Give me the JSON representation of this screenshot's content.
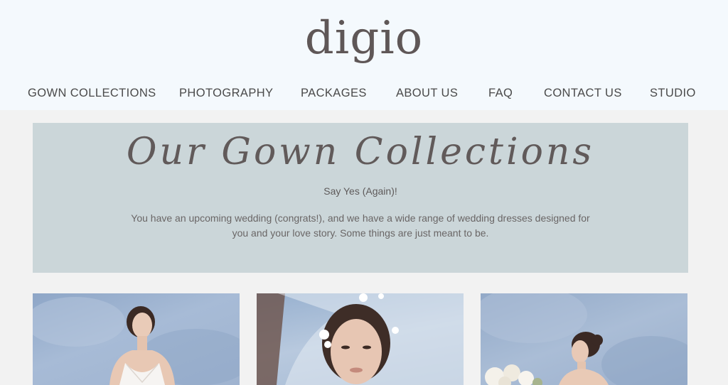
{
  "brand": {
    "logo_text": "digio"
  },
  "nav": {
    "items": [
      {
        "label": "GOWN COLLECTIONS"
      },
      {
        "label": "PHOTOGRAPHY"
      },
      {
        "label": "PACKAGES"
      },
      {
        "label": "ABOUT US"
      },
      {
        "label": "FAQ"
      },
      {
        "label": "CONTACT US"
      },
      {
        "label": "STUDIO"
      }
    ]
  },
  "hero": {
    "title": "Our Gown Collections",
    "subtitle": "Say Yes (Again)!",
    "description_line1": "You have an upcoming wedding (congrats!), and we have a wide range of wedding dresses designed for",
    "description_line2": "you and your love story. Some things are just meant to be."
  },
  "gallery": {
    "cards": [
      {
        "alt": "bride-in-lace-gown-photo"
      },
      {
        "alt": "bride-with-veil-closeup-photo"
      },
      {
        "alt": "bride-holding-bouquet-photo"
      }
    ]
  },
  "colors": {
    "header_bg": "#f4f9fd",
    "hero_bg": "#cbd6d9",
    "page_bg": "#f2f2f2",
    "text_dark": "#5f5757"
  }
}
